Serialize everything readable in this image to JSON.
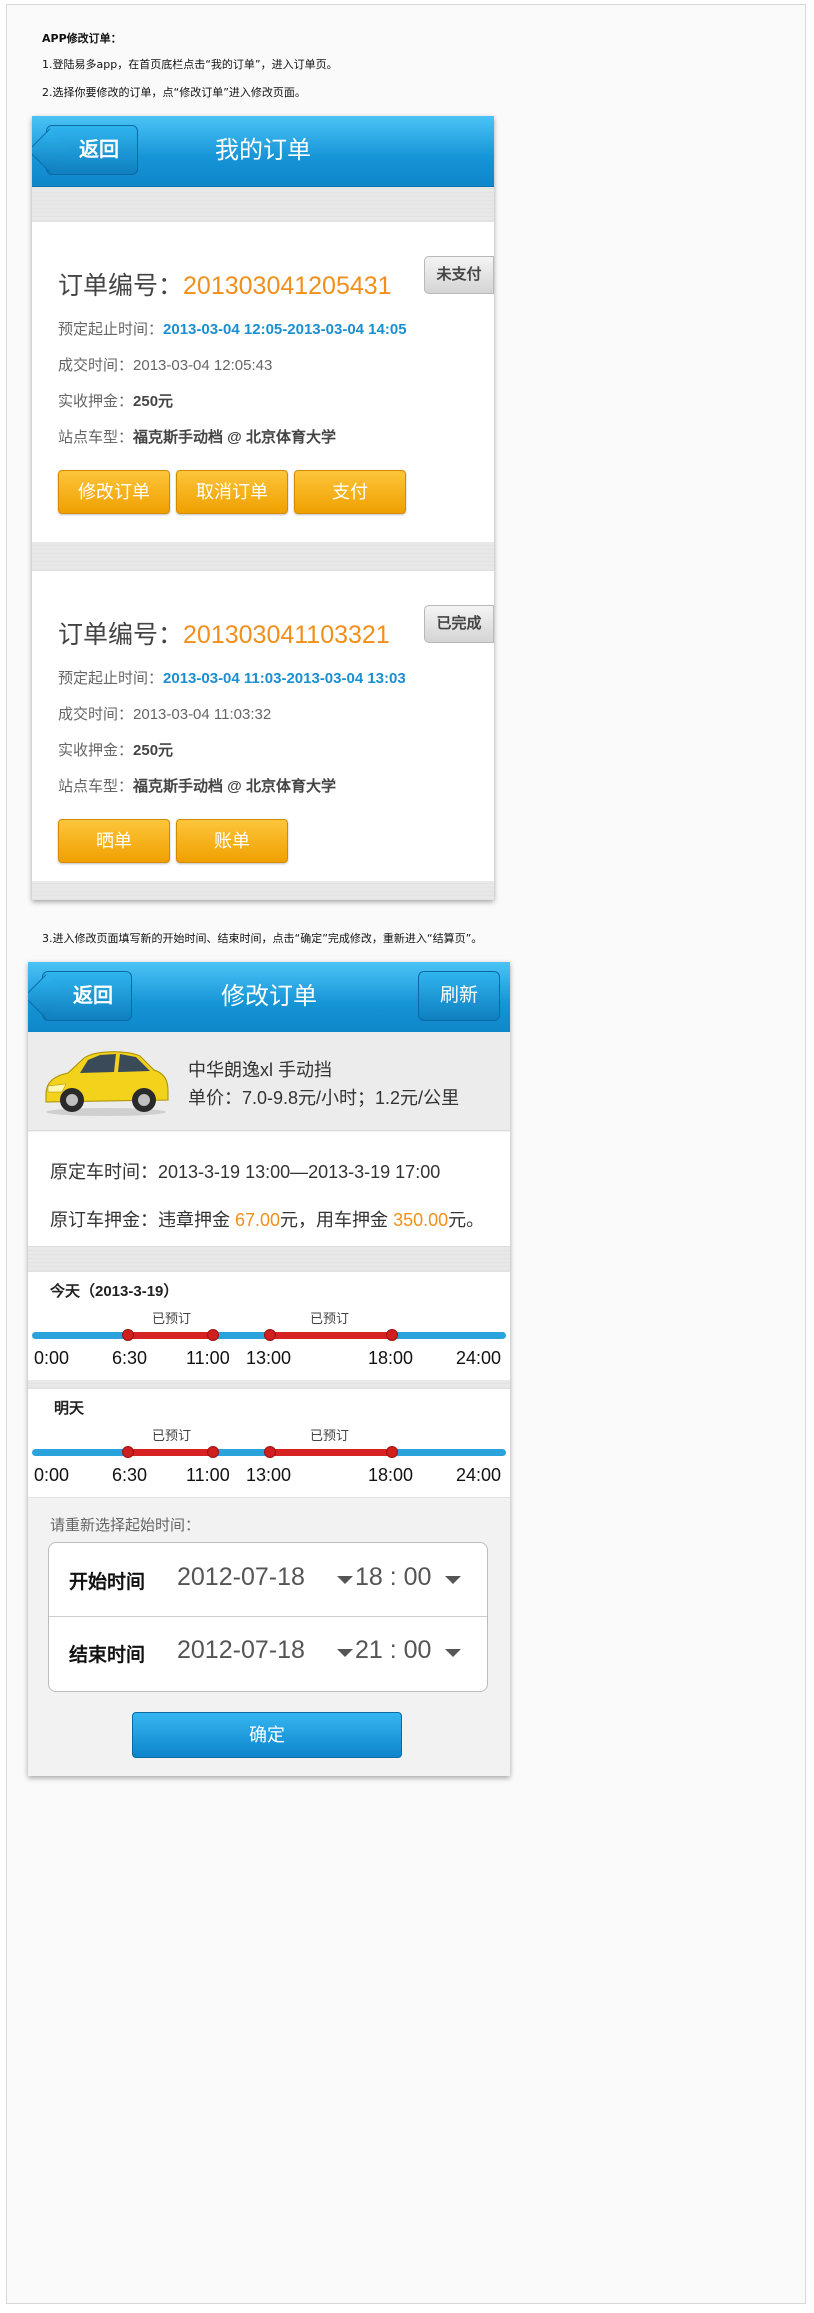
{
  "instructions": {
    "heading": "APP修改订单：",
    "step1": "1.登陆易多app，在首页底栏点击“我的订单”，进入订单页。",
    "step2": "2.选择你要修改的订单，点“修改订单”进入修改页面。",
    "step3": "3.进入修改页面填写新的开始时间、结束时间，点击“确定”完成修改，重新进入“结算页”。"
  },
  "orders_screen": {
    "title": "我的订单",
    "back_label": "返回",
    "orders": [
      {
        "no_label": "订单编号：",
        "no": "201303041205431",
        "status": "未支付",
        "reserve_label": "预定起止时间：",
        "reserve": "2013-03-04 12:05-2013-03-04 14:05",
        "deal_label": "成交时间：",
        "deal": "2013-03-04 12:05:43",
        "deposit_label": "实收押金：",
        "deposit": "250元",
        "station_label": "站点车型：",
        "station": "福克斯手动档 @ 北京体育大学",
        "buttons": [
          "修改订单",
          "取消订单",
          "支付"
        ]
      },
      {
        "no_label": "订单编号：",
        "no": "201303041103321",
        "status": "已完成",
        "reserve_label": "预定起止时间：",
        "reserve": "2013-03-04 11:03-2013-03-04 13:03",
        "deal_label": "成交时间：",
        "deal": "2013-03-04 11:03:32",
        "deposit_label": "实收押金：",
        "deposit": "250元",
        "station_label": "站点车型：",
        "station": "福克斯手动档 @ 北京体育大学",
        "buttons": [
          "晒单",
          "账单"
        ]
      }
    ]
  },
  "modify_screen": {
    "title": "修改订单",
    "back_label": "返回",
    "refresh_label": "刷新",
    "car_name": "中华朗逸xl 手动挡",
    "car_price": "单价：7.0-9.8元/小时；1.2元/公里",
    "orig_time": "原定车时间：2013-3-19 13:00—2013-3-19 17:00",
    "orig_deposit_prefix": "原订车押金：违章押金 ",
    "violation_deposit": "67.00",
    "orig_deposit_mid": "元，用车押金 ",
    "car_deposit": "350.00",
    "orig_deposit_suffix": "元。",
    "timelines": [
      {
        "label": "今天（2013-3-19）",
        "booked_label": "已预订",
        "ticks": [
          "0:00",
          "6:30",
          "11:00",
          "13:00",
          "18:00",
          "24:00"
        ],
        "booked": [
          [
            "6:30",
            "11:00"
          ],
          [
            "13:00",
            "18:00"
          ]
        ]
      },
      {
        "label": "明天",
        "booked_label": "已预订",
        "ticks": [
          "0:00",
          "6:30",
          "11:00",
          "13:00",
          "18:00",
          "24:00"
        ],
        "booked": [
          [
            "6:30",
            "11:00"
          ],
          [
            "13:00",
            "18:00"
          ]
        ]
      }
    ],
    "reselect_label": "请重新选择起始时间：",
    "start_label": "开始时间",
    "start_date": "2012-07-18",
    "start_time": "18 : 00",
    "end_label": "结束时间",
    "end_date": "2012-07-18",
    "end_time": "21 : 00",
    "confirm_label": "确定"
  },
  "colors": {
    "nav_blue": "#1594d6",
    "button_orange": "#f0a000",
    "highlight_orange": "#f28f1b",
    "link_blue": "#1a8fd0",
    "booked_red": "#d62222"
  }
}
